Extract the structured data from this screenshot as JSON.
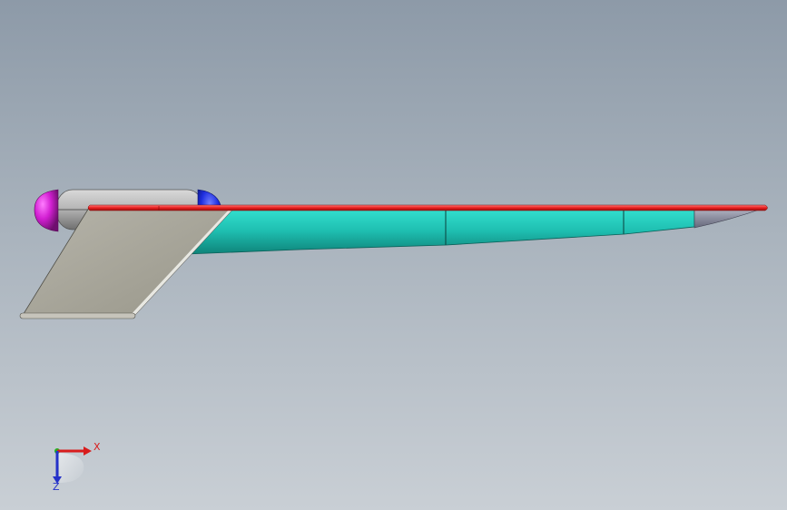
{
  "viewport": {
    "background_top": "#8d9aa8",
    "background_bottom": "#c9cfd5"
  },
  "model": {
    "parts": [
      "fuselage-pod",
      "nose-cap",
      "tail-cap",
      "vertical-fin",
      "main-wing",
      "leading-edge-strip",
      "wing-tip"
    ],
    "colors": {
      "fuselage": "#b4b4b4",
      "nose_cap": "#d21fd2",
      "tail_cap": "#1f2fe0",
      "fin": "#a7a59b",
      "wing": "#22c7b9",
      "leading_edge": "#e81f1f",
      "tip": "#8c8ea0"
    }
  },
  "triad": {
    "x_label": "X",
    "z_label": "Z",
    "x_color": "#d81c1c",
    "y_color": "#21b221",
    "z_color": "#2431c9"
  }
}
